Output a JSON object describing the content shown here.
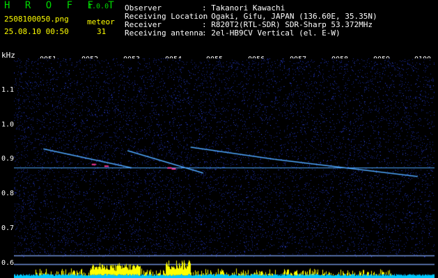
{
  "header": {
    "app_title": "H R O F F T",
    "app_version": "1.0.0",
    "filename": "2508100050.png",
    "datetime": "25.08.10 00:50",
    "meteor_label": "meteor",
    "meteor_count": "31"
  },
  "station": {
    "observer_label": "Observer",
    "observer_value": ": Takanori Kawachi",
    "location_label": "Receiving Location",
    "location_value": ": Ogaki, Gifu, JAPAN (136.60E, 35.35N)",
    "receiver_label": "Receiver",
    "receiver_value": ": R820T2(RTL-SDR) SDR-Sharp 53.372MHz",
    "antenna_label": "Receiving antenna",
    "antenna_value": ": 2el-HB9CV Vertical (el. E-W)"
  },
  "spectrogram": {
    "unit_label": "kHz",
    "time_ticks": [
      "0051",
      "0052",
      "0053",
      "0054",
      "0055",
      "0056",
      "0057",
      "0058",
      "0059",
      "0100"
    ],
    "freq_ticks": [
      "1.1",
      "1.0",
      "0.9",
      "0.8",
      "0.7",
      "0.6"
    ],
    "carrier_khz": 0.875,
    "colors": {
      "background": "#000000",
      "noise": "#1a2a9a",
      "trace": "#4fa8ff",
      "hot": "#ff3aa0",
      "axis_text": "#ffffff",
      "header_green": "#00d800",
      "header_yellow": "#ffff00",
      "activity": "#ffff00",
      "activity_base": "#00c8ff"
    }
  }
}
